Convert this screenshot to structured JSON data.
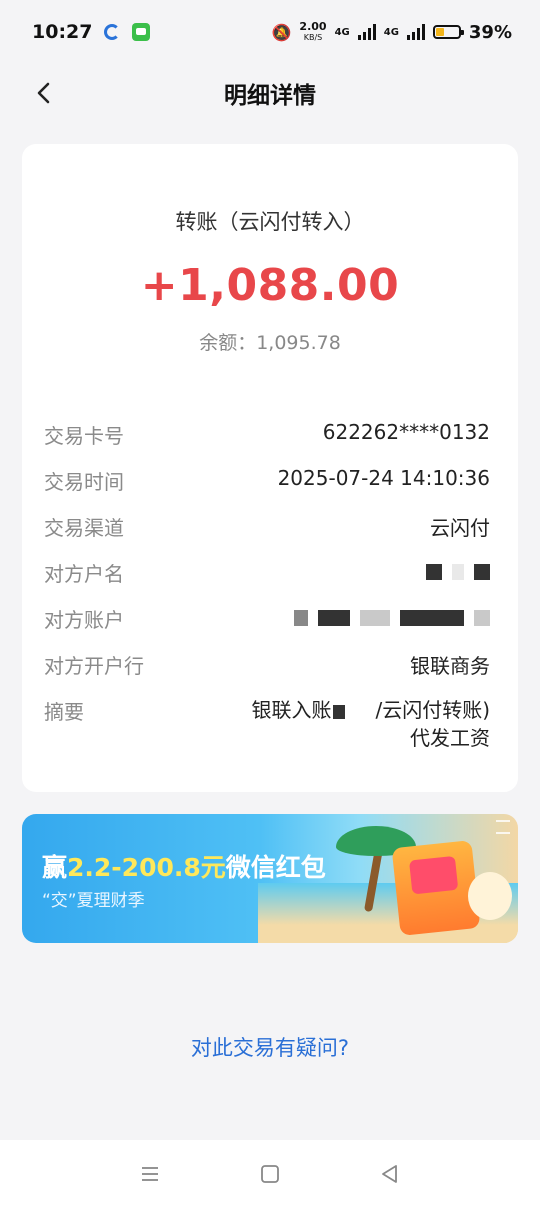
{
  "status_bar": {
    "time": "10:27",
    "speed_value": "2.00",
    "speed_unit": "KB/S",
    "network_1": "4G",
    "network_2": "4G",
    "battery_percent": "39%",
    "battery_level": 0.39
  },
  "header": {
    "title": "明细详情"
  },
  "transaction": {
    "type": "转账（云闪付转入）",
    "amount": "+1,088.00",
    "balance": "余额：1,095.78",
    "amount_color": "#e8474a"
  },
  "details": {
    "card_label": "交易卡号",
    "card_value": "622262****0132",
    "time_label": "交易时间",
    "time_value": "2025-07-24 14:10:36",
    "channel_label": "交易渠道",
    "channel_value": "云闪付",
    "payer_name_label": "对方户名",
    "payer_account_label": "对方账户",
    "payer_bank_label": "对方开户行",
    "payer_bank_value": "银联商务",
    "summary_label": "摘要",
    "summary_value_part1": "银联入账",
    "summary_value_part2": "/云闪付转账)代发工资"
  },
  "banner": {
    "title_prefix": "赢",
    "title_number": "2.2-200.8元",
    "title_suffix": "微信红包",
    "subtitle": "“交”夏理财季"
  },
  "question_link": "对此交易有疑问?"
}
